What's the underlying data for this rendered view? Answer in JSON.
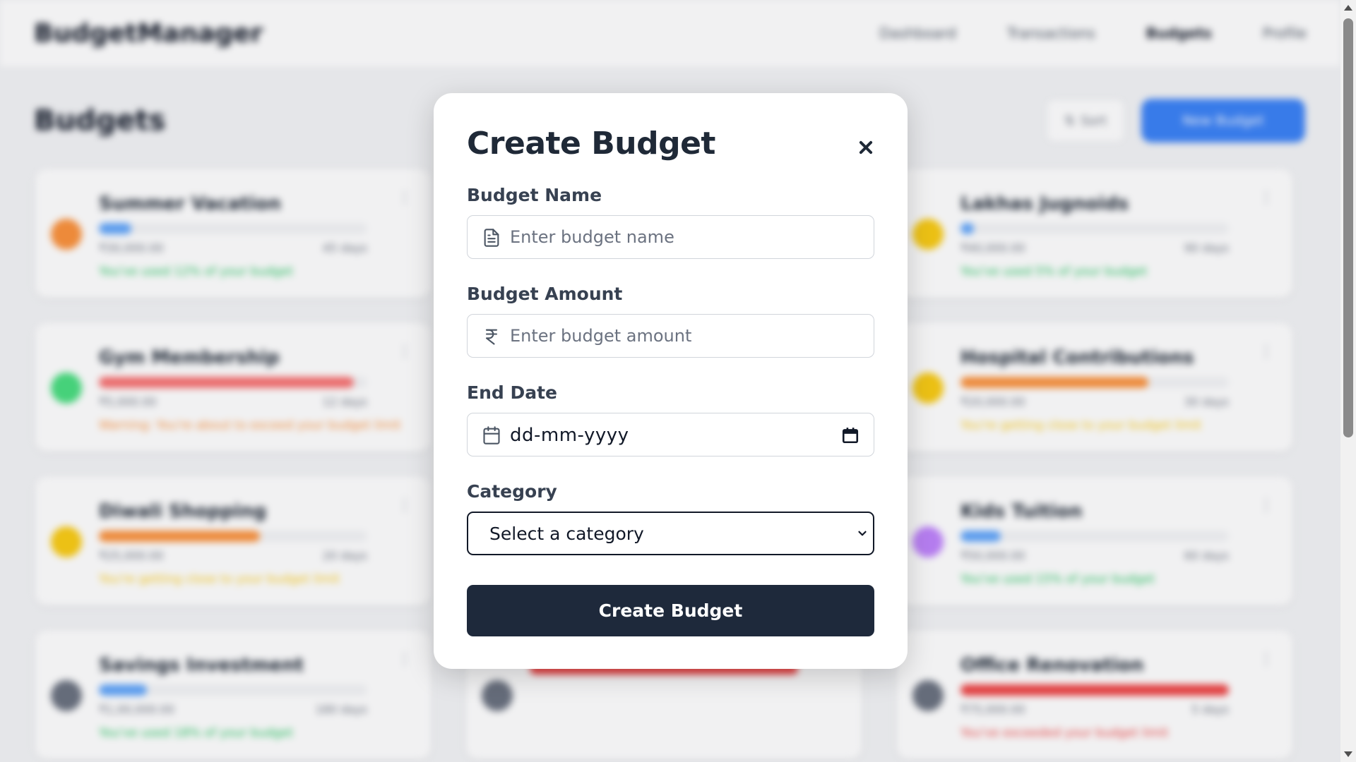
{
  "app": {
    "brand": "BudgetManager",
    "nav": [
      "Dashboard",
      "Transactions",
      "Budgets",
      "Profile"
    ],
    "page_title": "Budgets",
    "sort_label": "Sort",
    "new_budget_label": "New Budget"
  },
  "cards": [
    {
      "name": "Summer Vacation",
      "color": "#fb923c",
      "bar_color": "#60a5fa",
      "bar_fill": 0.12,
      "meta_left": "₹30,000.00",
      "meta_right": "45 days",
      "status": "You've used 12% of your budget",
      "status_color": "#22c55e"
    },
    {
      "name": "",
      "color": "#9ca3af",
      "bar_color": "#60a5fa",
      "bar_fill": 0.1,
      "meta_left": "",
      "meta_right": "",
      "status": "",
      "status_color": "#22c55e"
    },
    {
      "name": "Lakhas Jugnoids",
      "color": "#facc15",
      "bar_color": "#60a5fa",
      "bar_fill": 0.05,
      "meta_left": "₹40,000.00",
      "meta_right": "90 days",
      "status": "You've used 5% of your budget",
      "status_color": "#22c55e"
    },
    {
      "name": "Gym Membership",
      "color": "#4ade80",
      "bar_color": "#f87171",
      "bar_fill": 0.95,
      "meta_left": "₹5,000.00",
      "meta_right": "12 days",
      "status": "Warning: You're about to exceed your budget limit",
      "status_color": "#fb923c"
    },
    {
      "name": "",
      "color": "#9ca3af",
      "bar_color": "#fb923c",
      "bar_fill": 0.6,
      "meta_left": "",
      "meta_right": "",
      "status": "",
      "status_color": "#facc15"
    },
    {
      "name": "Hospital Contributions",
      "color": "#facc15",
      "bar_color": "#fb923c",
      "bar_fill": 0.7,
      "meta_left": "₹20,000.00",
      "meta_right": "30 days",
      "status": "You're getting close to your budget limit",
      "status_color": "#facc15"
    },
    {
      "name": "Diwali Shopping",
      "color": "#facc15",
      "bar_color": "#fb923c",
      "bar_fill": 0.6,
      "meta_left": "₹25,000.00",
      "meta_right": "20 days",
      "status": "You're getting close to your budget limit",
      "status_color": "#facc15"
    },
    {
      "name": "",
      "color": "#9ca3af",
      "bar_color": "#60a5fa",
      "bar_fill": 0.2,
      "meta_left": "",
      "meta_right": "",
      "status": "",
      "status_color": "#22c55e"
    },
    {
      "name": "Kids Tuition",
      "color": "#c084fc",
      "bar_color": "#60a5fa",
      "bar_fill": 0.15,
      "meta_left": "₹50,000.00",
      "meta_right": "60 days",
      "status": "You've used 15% of your budget",
      "status_color": "#22c55e"
    },
    {
      "name": "Savings Investment",
      "color": "#6b7280",
      "bar_color": "#60a5fa",
      "bar_fill": 0.18,
      "meta_left": "₹1,00,000.00",
      "meta_right": "180 days",
      "status": "You've used 18% of your budget",
      "status_color": "#22c55e"
    },
    {
      "name": "",
      "color": "#6b7280",
      "bar_color": "#ef4444",
      "bar_fill": 1.0,
      "meta_left": "",
      "meta_right": "",
      "status": "",
      "status_color": "#ef4444"
    },
    {
      "name": "Office Renovation",
      "color": "#6b7280",
      "bar_color": "#ef4444",
      "bar_fill": 1.0,
      "meta_left": "₹75,000.00",
      "meta_right": "5 days",
      "status": "You've exceeded your budget limit",
      "status_color": "#ef4444"
    }
  ],
  "modal": {
    "title": "Create Budget",
    "budget_name": {
      "label": "Budget Name",
      "placeholder": "Enter budget name",
      "icon": "document-icon"
    },
    "budget_amount": {
      "label": "Budget Amount",
      "placeholder": "Enter budget amount",
      "icon": "rupee-icon"
    },
    "end_date": {
      "label": "End Date",
      "value": "dd-mm-yyyy",
      "icon": "calendar-icon"
    },
    "category": {
      "label": "Category",
      "selected": "Select a category"
    },
    "submit_label": "Create Budget"
  }
}
